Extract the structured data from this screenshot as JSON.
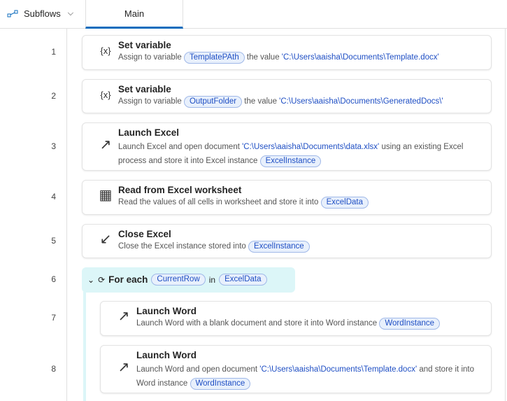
{
  "header": {
    "subflows_label": "Subflows",
    "tab_main": "Main"
  },
  "steps": [
    {
      "n": "1",
      "icon": "variable-icon",
      "glyph": "{x}",
      "title": "Set variable",
      "desc": [
        {
          "t": "Assign to variable "
        },
        {
          "v": "TemplatePAth"
        },
        {
          "t": " the value "
        },
        {
          "s": "'C:\\Users\\aaisha\\Documents\\Template.docx'"
        }
      ]
    },
    {
      "n": "2",
      "icon": "variable-icon",
      "glyph": "{x}",
      "title": "Set variable",
      "desc": [
        {
          "t": "Assign to variable "
        },
        {
          "v": "OutputFolder"
        },
        {
          "t": " the value "
        },
        {
          "s": "'C:\\Users\\aaisha\\Documents\\GeneratedDocs\\'"
        }
      ]
    },
    {
      "n": "3",
      "icon": "launch-arrow-icon",
      "glyph": "↗",
      "title": "Launch Excel",
      "desc": [
        {
          "t": "Launch Excel and open document "
        },
        {
          "s": "'C:\\Users\\aaisha\\Documents\\data.xlsx'"
        },
        {
          "t": " using an existing Excel process and store it into Excel instance "
        },
        {
          "v": "ExcelInstance"
        }
      ]
    },
    {
      "n": "4",
      "icon": "excel-worksheet-icon",
      "glyph": "▦",
      "title": "Read from Excel worksheet",
      "desc": [
        {
          "t": "Read the values of all cells in worksheet and store it into "
        },
        {
          "v": "ExcelData"
        }
      ]
    },
    {
      "n": "5",
      "icon": "close-arrow-icon",
      "glyph": "↙",
      "title": "Close Excel",
      "desc": [
        {
          "t": "Close the Excel instance stored into "
        },
        {
          "v": "ExcelInstance"
        }
      ]
    },
    {
      "n": "6",
      "loop": true,
      "title": "For each",
      "var": "CurrentRow",
      "in": "in",
      "list": "ExcelData"
    },
    {
      "n": "7",
      "icon": "launch-arrow-icon",
      "glyph": "↗",
      "title": "Launch Word",
      "desc": [
        {
          "t": "Launch Word with a blank document and store it into Word instance "
        },
        {
          "v": "WordInstance"
        }
      ]
    },
    {
      "n": "8",
      "icon": "launch-arrow-icon",
      "glyph": "↗",
      "title": "Launch Word",
      "desc": [
        {
          "t": "Launch Word and open document "
        },
        {
          "s": "'C:\\Users\\aaisha\\Documents\\Template.docx'"
        },
        {
          "t": " and store it into Word instance "
        },
        {
          "v": "WordInstance"
        }
      ]
    }
  ]
}
